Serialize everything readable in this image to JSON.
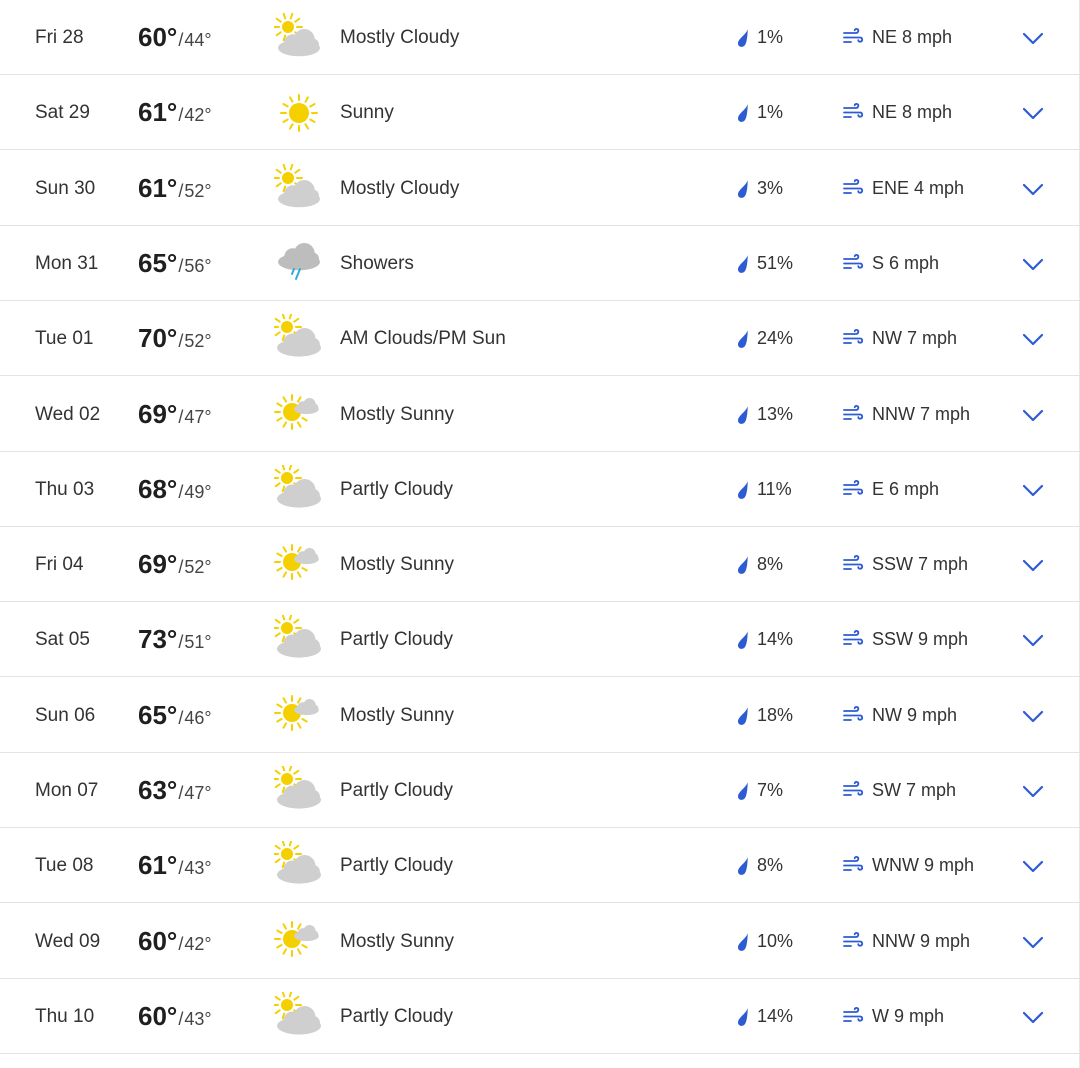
{
  "colors": {
    "accent": "#2d5bd3",
    "sun": "#f5d000",
    "cloud": "#cfcfcf",
    "rain_cloud": "#bdbdbd",
    "rain_drop": "#33a8e0"
  },
  "forecast": [
    {
      "day": "Fri 28",
      "high": "60°",
      "low": "44°",
      "condition": "Mostly Cloudy",
      "icon": "mostly-cloudy-icon",
      "precip": "1%",
      "wind": "NE 8 mph"
    },
    {
      "day": "Sat 29",
      "high": "61°",
      "low": "42°",
      "condition": "Sunny",
      "icon": "sunny-icon",
      "precip": "1%",
      "wind": "NE 8 mph"
    },
    {
      "day": "Sun 30",
      "high": "61°",
      "low": "52°",
      "condition": "Mostly Cloudy",
      "icon": "mostly-cloudy-icon",
      "precip": "3%",
      "wind": "ENE 4 mph"
    },
    {
      "day": "Mon 31",
      "high": "65°",
      "low": "56°",
      "condition": "Showers",
      "icon": "showers-icon",
      "precip": "51%",
      "wind": "S 6 mph"
    },
    {
      "day": "Tue 01",
      "high": "70°",
      "low": "52°",
      "condition": "AM Clouds/PM Sun",
      "icon": "partly-cloudy-icon",
      "precip": "24%",
      "wind": "NW 7 mph"
    },
    {
      "day": "Wed 02",
      "high": "69°",
      "low": "47°",
      "condition": "Mostly Sunny",
      "icon": "mostly-sunny-icon",
      "precip": "13%",
      "wind": "NNW 7 mph"
    },
    {
      "day": "Thu 03",
      "high": "68°",
      "low": "49°",
      "condition": "Partly Cloudy",
      "icon": "partly-cloudy-icon",
      "precip": "11%",
      "wind": "E 6 mph"
    },
    {
      "day": "Fri 04",
      "high": "69°",
      "low": "52°",
      "condition": "Mostly Sunny",
      "icon": "mostly-sunny-icon",
      "precip": "8%",
      "wind": "SSW 7 mph"
    },
    {
      "day": "Sat 05",
      "high": "73°",
      "low": "51°",
      "condition": "Partly Cloudy",
      "icon": "partly-cloudy-icon",
      "precip": "14%",
      "wind": "SSW 9 mph"
    },
    {
      "day": "Sun 06",
      "high": "65°",
      "low": "46°",
      "condition": "Mostly Sunny",
      "icon": "mostly-sunny-icon",
      "precip": "18%",
      "wind": "NW 9 mph"
    },
    {
      "day": "Mon 07",
      "high": "63°",
      "low": "47°",
      "condition": "Partly Cloudy",
      "icon": "partly-cloudy-icon",
      "precip": "7%",
      "wind": "SW 7 mph"
    },
    {
      "day": "Tue 08",
      "high": "61°",
      "low": "43°",
      "condition": "Partly Cloudy",
      "icon": "partly-cloudy-icon",
      "precip": "8%",
      "wind": "WNW 9 mph"
    },
    {
      "day": "Wed 09",
      "high": "60°",
      "low": "42°",
      "condition": "Mostly Sunny",
      "icon": "mostly-sunny-icon",
      "precip": "10%",
      "wind": "NNW 9 mph"
    },
    {
      "day": "Thu 10",
      "high": "60°",
      "low": "43°",
      "condition": "Partly Cloudy",
      "icon": "partly-cloudy-icon",
      "precip": "14%",
      "wind": "W 9 mph"
    }
  ]
}
